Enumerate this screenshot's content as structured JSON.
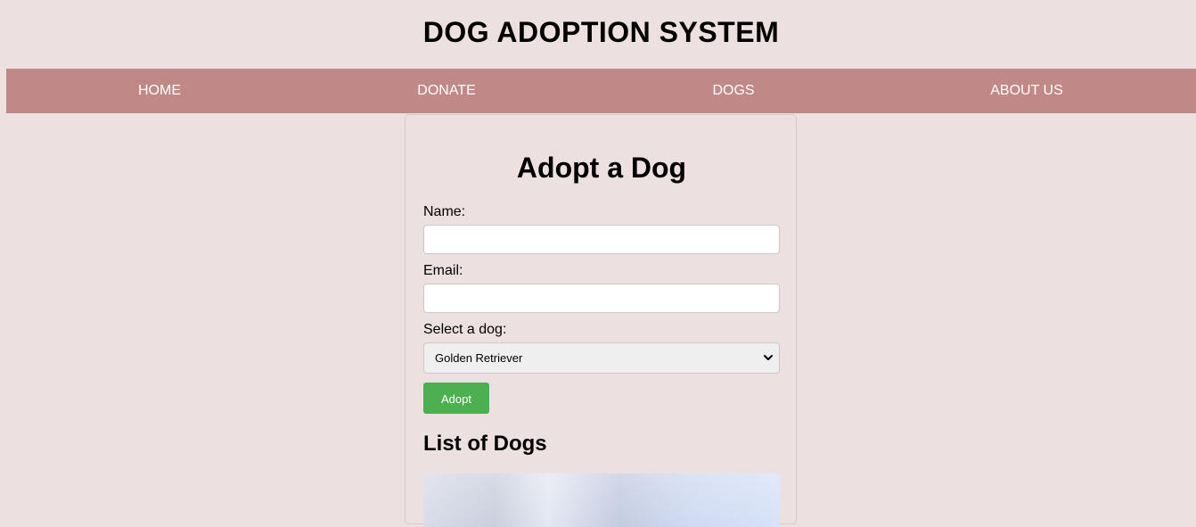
{
  "header": {
    "title": "DOG ADOPTION SYSTEM"
  },
  "nav": {
    "items": [
      {
        "label": "HOME"
      },
      {
        "label": "DONATE"
      },
      {
        "label": "DOGS"
      },
      {
        "label": "ABOUT US"
      }
    ]
  },
  "form": {
    "title": "Adopt a Dog",
    "name_label": "Name:",
    "name_value": "",
    "email_label": "Email:",
    "email_value": "",
    "dog_label": "Select a dog:",
    "dog_selected": "Golden Retriever",
    "submit_label": "Adopt"
  },
  "list": {
    "title": "List of Dogs"
  },
  "colors": {
    "background": "#ece0e0",
    "nav_background": "#c08886",
    "button": "#4caf50"
  }
}
